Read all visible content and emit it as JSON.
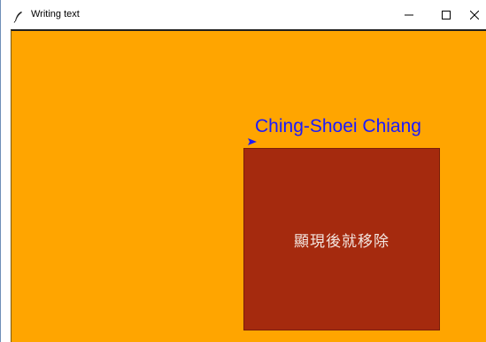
{
  "window": {
    "title": "Writing text"
  },
  "controls": {
    "minimize_icon": "minimize-icon",
    "maximize_icon": "maximize-icon",
    "close_icon": "close-icon"
  },
  "canvas": {
    "background": "#ffa500",
    "name_text": "Ching-Shoei Chiang",
    "name_color": "#1a1aff",
    "rect_color": "#a52a0e",
    "rect_text": "顯現後就移除"
  }
}
